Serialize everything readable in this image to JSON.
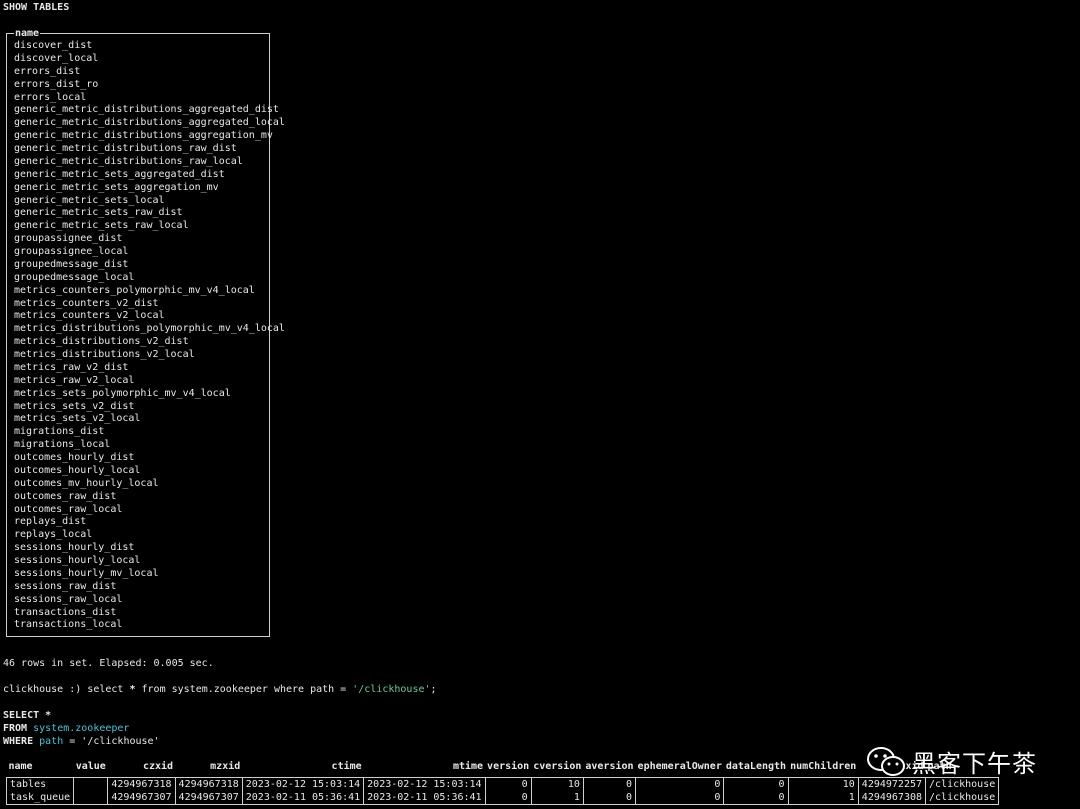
{
  "terminal": {
    "query1": "SHOW TABLES",
    "tables_header": "name",
    "tables": [
      "discover_dist",
      "discover_local",
      "errors_dist",
      "errors_dist_ro",
      "errors_local",
      "generic_metric_distributions_aggregated_dist",
      "generic_metric_distributions_aggregated_local",
      "generic_metric_distributions_aggregation_mv",
      "generic_metric_distributions_raw_dist",
      "generic_metric_distributions_raw_local",
      "generic_metric_sets_aggregated_dist",
      "generic_metric_sets_aggregation_mv",
      "generic_metric_sets_local",
      "generic_metric_sets_raw_dist",
      "generic_metric_sets_raw_local",
      "groupassignee_dist",
      "groupassignee_local",
      "groupedmessage_dist",
      "groupedmessage_local",
      "metrics_counters_polymorphic_mv_v4_local",
      "metrics_counters_v2_dist",
      "metrics_counters_v2_local",
      "metrics_distributions_polymorphic_mv_v4_local",
      "metrics_distributions_v2_dist",
      "metrics_distributions_v2_local",
      "metrics_raw_v2_dist",
      "metrics_raw_v2_local",
      "metrics_sets_polymorphic_mv_v4_local",
      "metrics_sets_v2_dist",
      "metrics_sets_v2_local",
      "migrations_dist",
      "migrations_local",
      "outcomes_hourly_dist",
      "outcomes_hourly_local",
      "outcomes_mv_hourly_local",
      "outcomes_raw_dist",
      "outcomes_raw_local",
      "replays_dist",
      "replays_local",
      "sessions_hourly_dist",
      "sessions_hourly_local",
      "sessions_hourly_mv_local",
      "sessions_raw_dist",
      "sessions_raw_local",
      "transactions_dist",
      "transactions_local"
    ],
    "rows_status": "46 rows in set. Elapsed: 0.005 sec.",
    "prompt": "clickhouse :) ",
    "cmd_pre": "select ",
    "cmd_star": "*",
    "cmd_mid": " from system.zookeeper where path = ",
    "cmd_str": "'/clickhouse'",
    "cmd_end": ";",
    "fmt_select_kw": "SELECT",
    "fmt_select_rest": " *",
    "fmt_from_kw": "FROM",
    "fmt_from_tbl": "system.zookeeper",
    "fmt_where_kw": "WHERE",
    "fmt_where_col": "path",
    "fmt_where_rest": " = '/clickhouse'"
  },
  "result": {
    "columns": [
      "name",
      "value",
      "czxid",
      "mzxid",
      "ctime",
      "mtime",
      "version",
      "cversion",
      "aversion",
      "ephemeralOwner",
      "dataLength",
      "numChildren",
      "pzxid",
      "path"
    ],
    "rows": [
      [
        "tables",
        "",
        "4294967318",
        "4294967318",
        "2023-02-12 15:03:14",
        "2023-02-12 15:03:14",
        "0",
        "10",
        "0",
        "0",
        "0",
        "10",
        "4294972257",
        "/clickhouse"
      ],
      [
        "task_queue",
        "",
        "4294967307",
        "4294967307",
        "2023-02-11 05:36:41",
        "2023-02-11 05:36:41",
        "0",
        "1",
        "0",
        "0",
        "0",
        "1",
        "4294967308",
        "/clickhouse"
      ]
    ]
  },
  "watermark": {
    "text": "黑客下午茶",
    "icon": "wechat-icon"
  }
}
